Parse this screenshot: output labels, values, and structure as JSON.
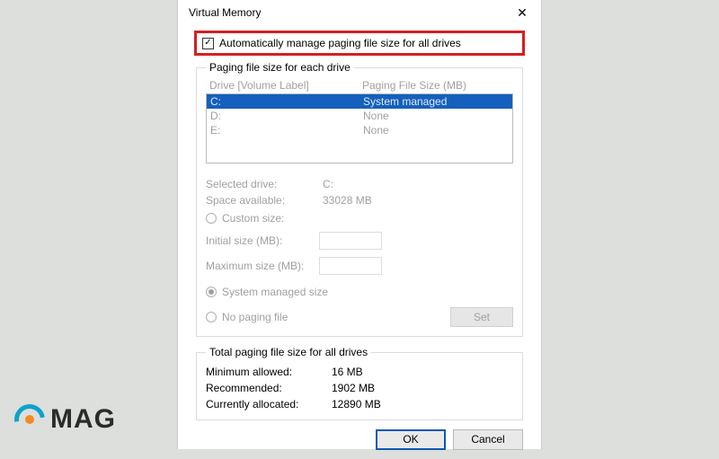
{
  "window": {
    "title": "Virtual Memory"
  },
  "auto_checkbox": {
    "checked": true,
    "label": "Automatically manage paging file size for all drives"
  },
  "drive_group": {
    "legend": "Paging file size for each drive",
    "header_drive": "Drive  [Volume Label]",
    "header_size": "Paging File Size (MB)",
    "rows": [
      {
        "drive": "C:",
        "size": "System managed",
        "selected": true
      },
      {
        "drive": "D:",
        "size": "None",
        "selected": false
      },
      {
        "drive": "E:",
        "size": "None",
        "selected": false
      }
    ],
    "selected_drive_label": "Selected drive:",
    "selected_drive_value": "C:",
    "space_available_label": "Space available:",
    "space_available_value": "33028 MB",
    "custom_size_label": "Custom size:",
    "initial_label": "Initial size (MB):",
    "maximum_label": "Maximum size (MB):",
    "system_managed_label": "System managed size",
    "no_paging_label": "No paging file",
    "set_label": "Set"
  },
  "totals": {
    "legend": "Total paging file size for all drives",
    "min_label": "Minimum allowed:",
    "min_value": "16 MB",
    "rec_label": "Recommended:",
    "rec_value": "1902 MB",
    "cur_label": "Currently allocated:",
    "cur_value": "12890 MB"
  },
  "buttons": {
    "ok": "OK",
    "cancel": "Cancel"
  },
  "logo_text": "MAG"
}
